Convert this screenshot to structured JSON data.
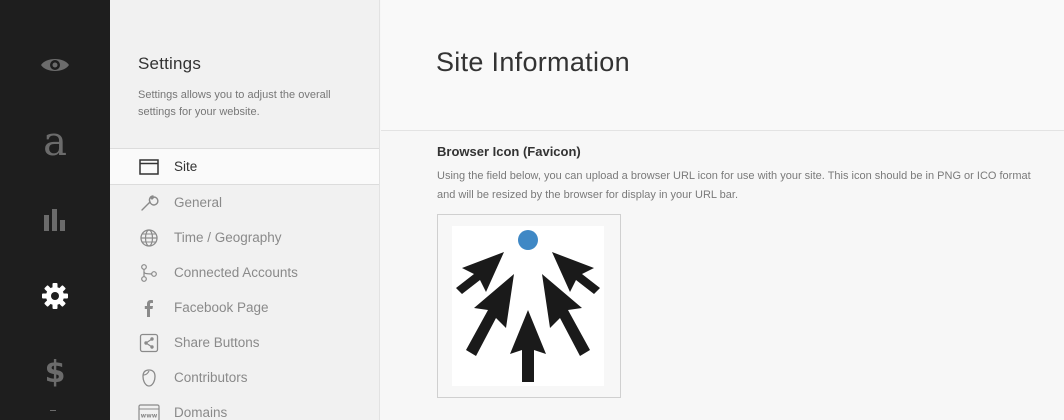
{
  "rail": {
    "items": [
      {
        "icon": "eye-icon"
      },
      {
        "icon": "typography-icon",
        "glyph": "a"
      },
      {
        "icon": "bar-chart-icon"
      },
      {
        "icon": "gear-icon",
        "active": true
      },
      {
        "icon": "dollar-icon",
        "glyph": "$"
      }
    ]
  },
  "settings": {
    "title": "Settings",
    "description": "Settings allows you to adjust the overall settings for your website.",
    "nav": [
      {
        "label": "Site",
        "icon": "browser-window-icon",
        "active": true
      },
      {
        "label": "General",
        "icon": "wrench-icon"
      },
      {
        "label": "Time / Geography",
        "icon": "globe-icon"
      },
      {
        "label": "Connected Accounts",
        "icon": "connections-icon"
      },
      {
        "label": "Facebook Page",
        "icon": "facebook-icon"
      },
      {
        "label": "Share Buttons",
        "icon": "share-icon"
      },
      {
        "label": "Contributors",
        "icon": "person-icon"
      },
      {
        "label": "Domains",
        "icon": "www-icon"
      }
    ]
  },
  "main": {
    "title": "Site Information",
    "favicon": {
      "heading": "Browser Icon (Favicon)",
      "description": "Using the field below, you can upload a browser URL icon for use with your site. This icon should be in PNG or ICO format and will be resized by the browser for display in your URL bar."
    }
  },
  "colors": {
    "rail_bg": "#1e1e1e",
    "rail_icon": "#6b6b6b",
    "rail_active": "#ffffff",
    "favicon_dot": "#3f88c5"
  }
}
